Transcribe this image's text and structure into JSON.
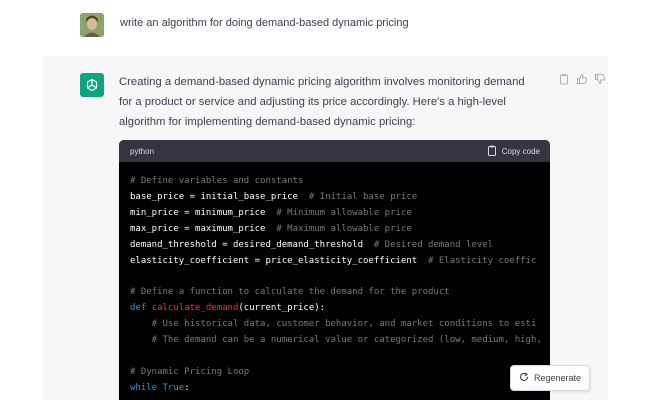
{
  "user": {
    "message": "write an algorithm for doing demand-based dynamic pricing"
  },
  "assistant": {
    "reply": "Creating a demand-based dynamic pricing algorithm involves monitoring demand for a product or service and adjusting its price accordingly. Here's a high-level algorithm for implementing demand-based dynamic pricing:",
    "actions": [
      "clipboard-icon",
      "thumbs-up-icon",
      "thumbs-down-icon"
    ]
  },
  "code": {
    "language": "python",
    "copy_label": "Copy code",
    "lines": [
      [
        {
          "t": "# Define variables and constants",
          "c": "comment"
        }
      ],
      [
        {
          "t": "base_price = initial_base_price  ",
          "c": "plain"
        },
        {
          "t": "# Initial base price",
          "c": "comment"
        }
      ],
      [
        {
          "t": "min_price = minimum_price  ",
          "c": "plain"
        },
        {
          "t": "# Minimum allowable price",
          "c": "comment"
        }
      ],
      [
        {
          "t": "max_price = maximum_price  ",
          "c": "plain"
        },
        {
          "t": "# Maximum allowable price",
          "c": "comment"
        }
      ],
      [
        {
          "t": "demand_threshold = desired_demand_threshold  ",
          "c": "plain"
        },
        {
          "t": "# Desired demand level",
          "c": "comment"
        }
      ],
      [
        {
          "t": "elasticity_coefficient = price_elasticity_coefficient  ",
          "c": "plain"
        },
        {
          "t": "# Elasticity coeffic",
          "c": "comment"
        }
      ],
      [
        {
          "t": "",
          "c": "plain"
        }
      ],
      [
        {
          "t": "# Define a function to calculate the demand for the product",
          "c": "comment"
        }
      ],
      [
        {
          "t": "def ",
          "c": "kw"
        },
        {
          "t": "calculate_demand",
          "c": "fn"
        },
        {
          "t": "(current_price):",
          "c": "plain"
        }
      ],
      [
        {
          "t": "    # Use historical data, customer behavior, and market conditions to esti",
          "c": "comment"
        }
      ],
      [
        {
          "t": "    # The demand can be a numerical value or categorized (low, medium, high,",
          "c": "comment"
        }
      ],
      [
        {
          "t": "",
          "c": "plain"
        }
      ],
      [
        {
          "t": "# Dynamic Pricing Loop",
          "c": "comment"
        }
      ],
      [
        {
          "t": "while ",
          "c": "kw"
        },
        {
          "t": "True",
          "c": "kw"
        },
        {
          "t": ":",
          "c": "plain"
        }
      ]
    ]
  },
  "regenerate_label": "Regenerate",
  "colors": {
    "assistant_bg": "#f7f7f8",
    "brand": "#10a37f",
    "code_bg": "#000000",
    "code_header_bg": "#343541",
    "keyword": "#2e95d3",
    "function_name": "#f22c3d",
    "comment": "#7a7a7a"
  }
}
